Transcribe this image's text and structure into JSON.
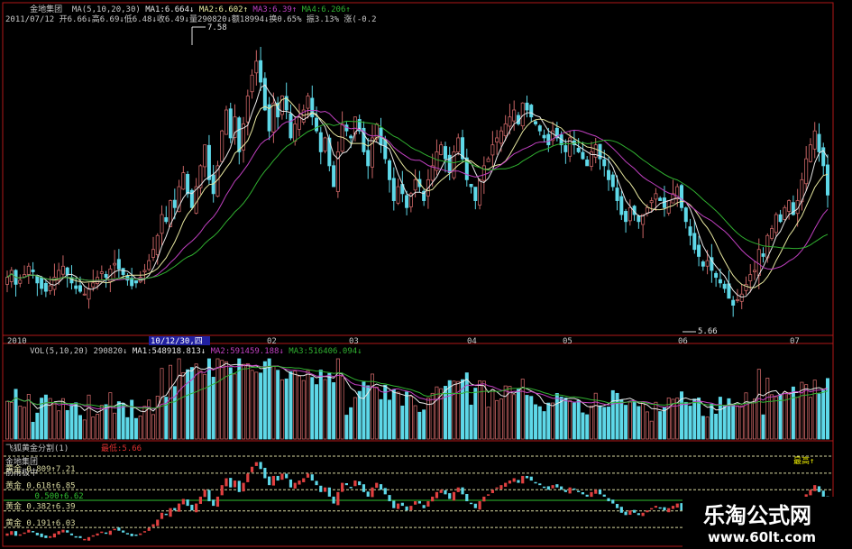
{
  "colors": {
    "background": "#000000",
    "frame": "#b01818",
    "up": "#c86464",
    "down": "#5ed8e8",
    "text": "#c8c8c8",
    "ma5": "#e8e8e8",
    "ma10": "#e8e8a0",
    "ma20": "#c040c0",
    "ma30": "#30b030",
    "gold": "#d8d8a0",
    "highlight": "#e6e600",
    "label_bg": "#2020a0"
  },
  "header": {
    "line1": [
      {
        "text": "金地集团  MA(5,10,20,30)",
        "color": "#c8c8c8"
      },
      {
        "text": " MA1:6.664↓",
        "color": "#e8e8e8"
      },
      {
        "text": " MA2:6.602↑",
        "color": "#e8e8a0"
      },
      {
        "text": " MA3:6.39↑",
        "color": "#c040c0"
      },
      {
        "text": " MA4:6.206↑",
        "color": "#30b030"
      }
    ],
    "line2": "2011/07/12 开6.66↓高6.69↓低6.48↓收6.49↓量290820↓额18994↓换0.65% 振3.13% 涨(-0.2"
  },
  "price_panel": {
    "high_label": "7.58",
    "low_label": "5.66",
    "x_axis": [
      "2010",
      "10/12/30,四",
      "02",
      "03",
      "04",
      "05",
      "06",
      "07"
    ]
  },
  "volume_panel": {
    "header": [
      {
        "text": "VOL(5,10,20) 290820↓",
        "color": "#c8c8c8"
      },
      {
        "text": " MA1:548918.813↓",
        "color": "#e8e8e8"
      },
      {
        "text": " MA2:591459.188↓",
        "color": "#c040c0"
      },
      {
        "text": " MA3:516406.094↓",
        "color": "#30b030"
      }
    ]
  },
  "gold_panel": {
    "title": "飞狐黄金分割(1)",
    "low_label": "最低:5.66",
    "stock": "金地集团",
    "sub": "前雨极中",
    "high_tag": "最高↑",
    "levels": [
      {
        "ratio": "0.809",
        "price": "7.21"
      },
      {
        "ratio": "0.618",
        "price": "6.85"
      },
      {
        "ratio": "0.500",
        "price": "6.62"
      },
      {
        "ratio": "0.382",
        "price": "6.39"
      },
      {
        "ratio": "0.191",
        "price": "6.03"
      }
    ]
  },
  "watermark": {
    "title": "乐淘公式网",
    "url": "www.60lt.com"
  },
  "chart_data": {
    "type": "candlestick",
    "stock": "金地集团",
    "price_high": 7.58,
    "price_low": 5.66,
    "ma_periods": [
      5,
      10,
      20,
      30
    ],
    "ma_latest": {
      "MA1": 6.664,
      "MA2": 6.602,
      "MA3": 6.39,
      "MA4": 6.206
    },
    "last_bar": {
      "date": "2011/07/12",
      "open": 6.66,
      "high": 6.69,
      "low": 6.48,
      "close": 6.49,
      "volume": 290820,
      "amount": 18994,
      "turnover": "0.65%",
      "amplitude": "3.13%"
    },
    "volume_ma_latest": {
      "MA1": 548918.813,
      "MA2": 591459.188,
      "MA3": 516406.094
    },
    "month_labels": [
      "2010",
      "02",
      "03",
      "04",
      "05",
      "06",
      "07"
    ],
    "closes": [
      5.9,
      5.95,
      5.85,
      5.88,
      5.92,
      5.98,
      5.94,
      5.86,
      5.82,
      5.8,
      5.84,
      5.9,
      5.95,
      5.98,
      5.92,
      5.86,
      5.82,
      5.8,
      5.78,
      5.82,
      5.86,
      5.9,
      5.94,
      5.9,
      5.96,
      6.0,
      5.96,
      5.92,
      5.88,
      5.84,
      5.86,
      5.9,
      5.95,
      6.02,
      6.1,
      6.2,
      6.35,
      6.3,
      6.45,
      6.4,
      6.55,
      6.65,
      6.5,
      6.4,
      6.55,
      6.7,
      6.85,
      6.6,
      6.5,
      6.7,
      6.95,
      7.1,
      6.9,
      7.05,
      6.8,
      7.0,
      7.2,
      7.35,
      7.45,
      7.3,
      7.1,
      6.95,
      7.15,
      7.05,
      7.2,
      7.1,
      6.9,
      7.0,
      7.05,
      7.1,
      7.2,
      7.05,
      6.95,
      6.8,
      6.9,
      6.7,
      6.55,
      6.8,
      7.0,
      6.95,
      6.9,
      7.05,
      6.95,
      6.8,
      6.7,
      6.9,
      7.0,
      6.85,
      6.75,
      6.6,
      6.45,
      6.55,
      6.5,
      6.4,
      6.5,
      6.6,
      6.55,
      6.45,
      6.6,
      6.7,
      6.8,
      6.85,
      6.75,
      6.65,
      6.8,
      6.9,
      6.75,
      6.6,
      6.55,
      6.45,
      6.6,
      6.7,
      6.75,
      6.85,
      6.9,
      6.95,
      7.0,
      7.05,
      7.1,
      7.0,
      7.15,
      7.1,
      7.05,
      7.0,
      6.95,
      6.9,
      6.85,
      6.95,
      6.9,
      6.85,
      6.8,
      6.9,
      6.85,
      6.8,
      6.75,
      6.7,
      6.8,
      6.85,
      6.75,
      6.7,
      6.6,
      6.55,
      6.45,
      6.35,
      6.3,
      6.4,
      6.35,
      6.3,
      6.35,
      6.4,
      6.45,
      6.5,
      6.45,
      6.4,
      6.45,
      6.5,
      6.55,
      6.4,
      6.3,
      6.2,
      6.1,
      6.05,
      5.98,
      6.02,
      5.95,
      5.9,
      5.86,
      5.82,
      5.75,
      5.7,
      5.74,
      5.78,
      5.85,
      5.92,
      5.95,
      6.1,
      6.05,
      6.2,
      6.25,
      6.35,
      6.3,
      6.4,
      6.45,
      6.35,
      6.45,
      6.6,
      6.75,
      6.85,
      6.95,
      6.8,
      6.7,
      6.49
    ]
  }
}
